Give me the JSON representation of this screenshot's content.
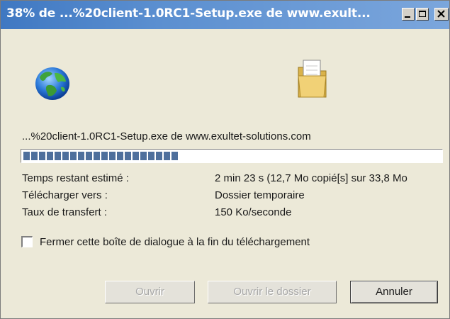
{
  "window": {
    "title": "38% de ...%20client-1.0RC1-Setup.exe de www.exult..."
  },
  "icons": {
    "source": "globe-icon",
    "destination": "folder-document-icon",
    "minimize": "minimize-icon",
    "maximize": "maximize-icon",
    "close": "close-icon"
  },
  "download": {
    "filename": "...%20client-1.0RC1-Setup.exe de www.exultet-solutions.com",
    "progress_fraction": 0.38,
    "info": [
      {
        "label": "Temps restant estimé :",
        "value": "2 min 23 s (12,7 Mo copié[s] sur 33,8 Mo"
      },
      {
        "label": "Télécharger vers :",
        "value": "Dossier temporaire"
      },
      {
        "label": "Taux de transfert :",
        "value": "150 Ko/seconde"
      }
    ]
  },
  "options": {
    "close_on_finish_label": "Fermer cette boîte de dialogue à la fin du téléchargement",
    "close_on_finish_checked": false
  },
  "buttons": {
    "open": "Ouvrir",
    "open_folder": "Ouvrir le dossier",
    "cancel": "Annuler"
  },
  "colors": {
    "titlebar_start": "#3f78c2",
    "titlebar_end": "#7ba6dc",
    "progress_block": "#4e6f9c",
    "dialog_background": "#ece9d8"
  }
}
